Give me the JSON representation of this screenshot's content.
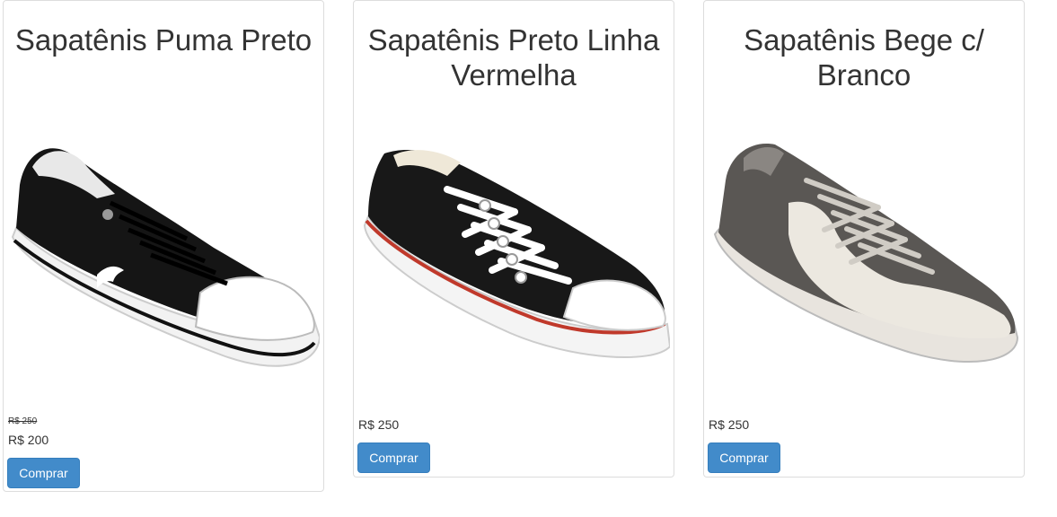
{
  "products": [
    {
      "title": "Sapatênis Puma Preto",
      "old_price": "R$ 250",
      "price": "R$ 200",
      "buy_label": "Comprar",
      "image": "black-puma-sneaker"
    },
    {
      "title": "Sapatênis Preto Linha Vermelha",
      "price": "R$ 250",
      "buy_label": "Comprar",
      "image": "black-canvas-sneaker-red-stripe"
    },
    {
      "title": "Sapatênis Bege c/ Branco",
      "price": "R$ 250",
      "buy_label": "Comprar",
      "image": "gray-beige-white-sneaker"
    }
  ],
  "colors": {
    "button": "#428bca",
    "border": "#dddddd",
    "text": "#333333"
  }
}
